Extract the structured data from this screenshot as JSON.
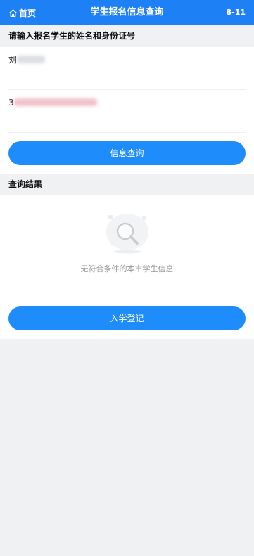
{
  "header": {
    "home_label": "首页",
    "title": "学生报名信息查询",
    "right_text": "8-11"
  },
  "query_section": {
    "heading": "请输入报名学生的姓名和身份证号",
    "name_field": {
      "visible_char": "刘"
    },
    "id_field": {
      "visible_char": "3"
    },
    "query_button": "信息查询"
  },
  "result_section": {
    "heading": "查询结果",
    "empty_message": "无符合条件的本市学生信息",
    "register_button": "入学登记"
  },
  "colors": {
    "primary": "#1e80f5",
    "button": "#1e8cfa",
    "background": "#f0f1f3"
  }
}
